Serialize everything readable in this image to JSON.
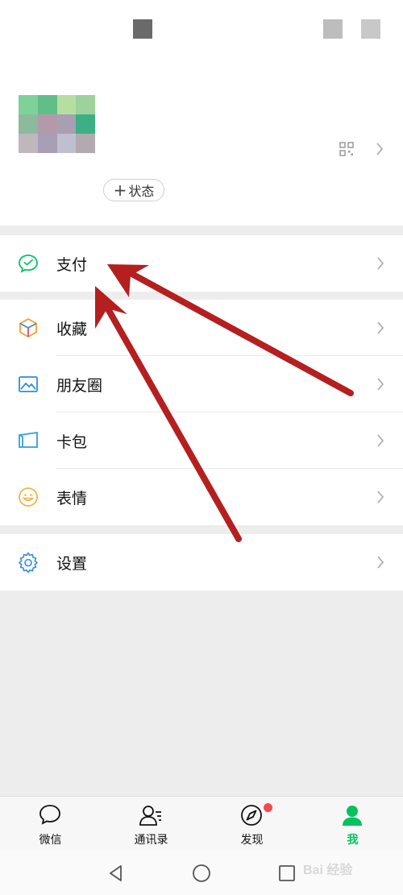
{
  "profile": {
    "status_button_plus": "+",
    "status_button_label": "状态",
    "avatar_colors": [
      "#7fd19a",
      "#5fbf86",
      "#b6dea2",
      "#9fd19a",
      "#8dba9e",
      "#b39aaa",
      "#a89fb0",
      "#3daf87",
      "#c0b7bd",
      "#a89eb5",
      "#bfc0cf",
      "#b3aab0"
    ]
  },
  "menu": {
    "pay": {
      "label": "支付",
      "icon": "wechat-pay-icon"
    },
    "favorites": {
      "label": "收藏",
      "icon": "cube-icon"
    },
    "moments": {
      "label": "朋友圈",
      "icon": "picture-icon"
    },
    "cards": {
      "label": "卡包",
      "icon": "card-wallet-icon"
    },
    "stickers": {
      "label": "表情",
      "icon": "smiley-icon"
    },
    "settings": {
      "label": "设置",
      "icon": "gear-icon"
    }
  },
  "tabbar": {
    "chats": "微信",
    "contacts": "通讯录",
    "discover": "发现",
    "me": "我"
  },
  "watermark": "Bai 经验",
  "colors": {
    "accent": "#07c160",
    "arrow": "#b51f1f",
    "badge": "#f24b4b"
  }
}
